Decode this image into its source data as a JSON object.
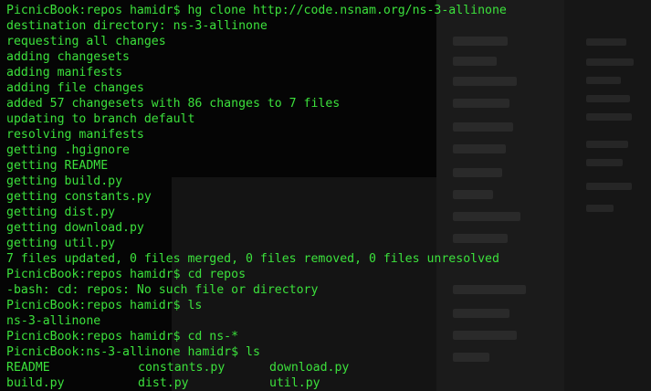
{
  "terminal": {
    "lines": [
      "PicnicBook:repos hamidr$ hg clone http://code.nsnam.org/ns-3-allinone",
      "destination directory: ns-3-allinone",
      "requesting all changes",
      "adding changesets",
      "adding manifests",
      "adding file changes",
      "added 57 changesets with 86 changes to 7 files",
      "updating to branch default",
      "resolving manifests",
      "getting .hgignore",
      "getting README",
      "getting build.py",
      "getting constants.py",
      "getting dist.py",
      "getting download.py",
      "getting util.py",
      "7 files updated, 0 files merged, 0 files removed, 0 files unresolved",
      "PicnicBook:repos hamidr$ cd repos",
      "-bash: cd: repos: No such file or directory",
      "PicnicBook:repos hamidr$ ls",
      "ns-3-allinone",
      "PicnicBook:repos hamidr$ cd ns-*",
      "PicnicBook:ns-3-allinone hamidr$ ls"
    ],
    "ls_output": [
      [
        "README",
        "constants.py",
        "download.py"
      ],
      [
        "build.py",
        "dist.py",
        "util.py"
      ]
    ],
    "text_color": "#3ce13c",
    "background_color": "#070707"
  }
}
